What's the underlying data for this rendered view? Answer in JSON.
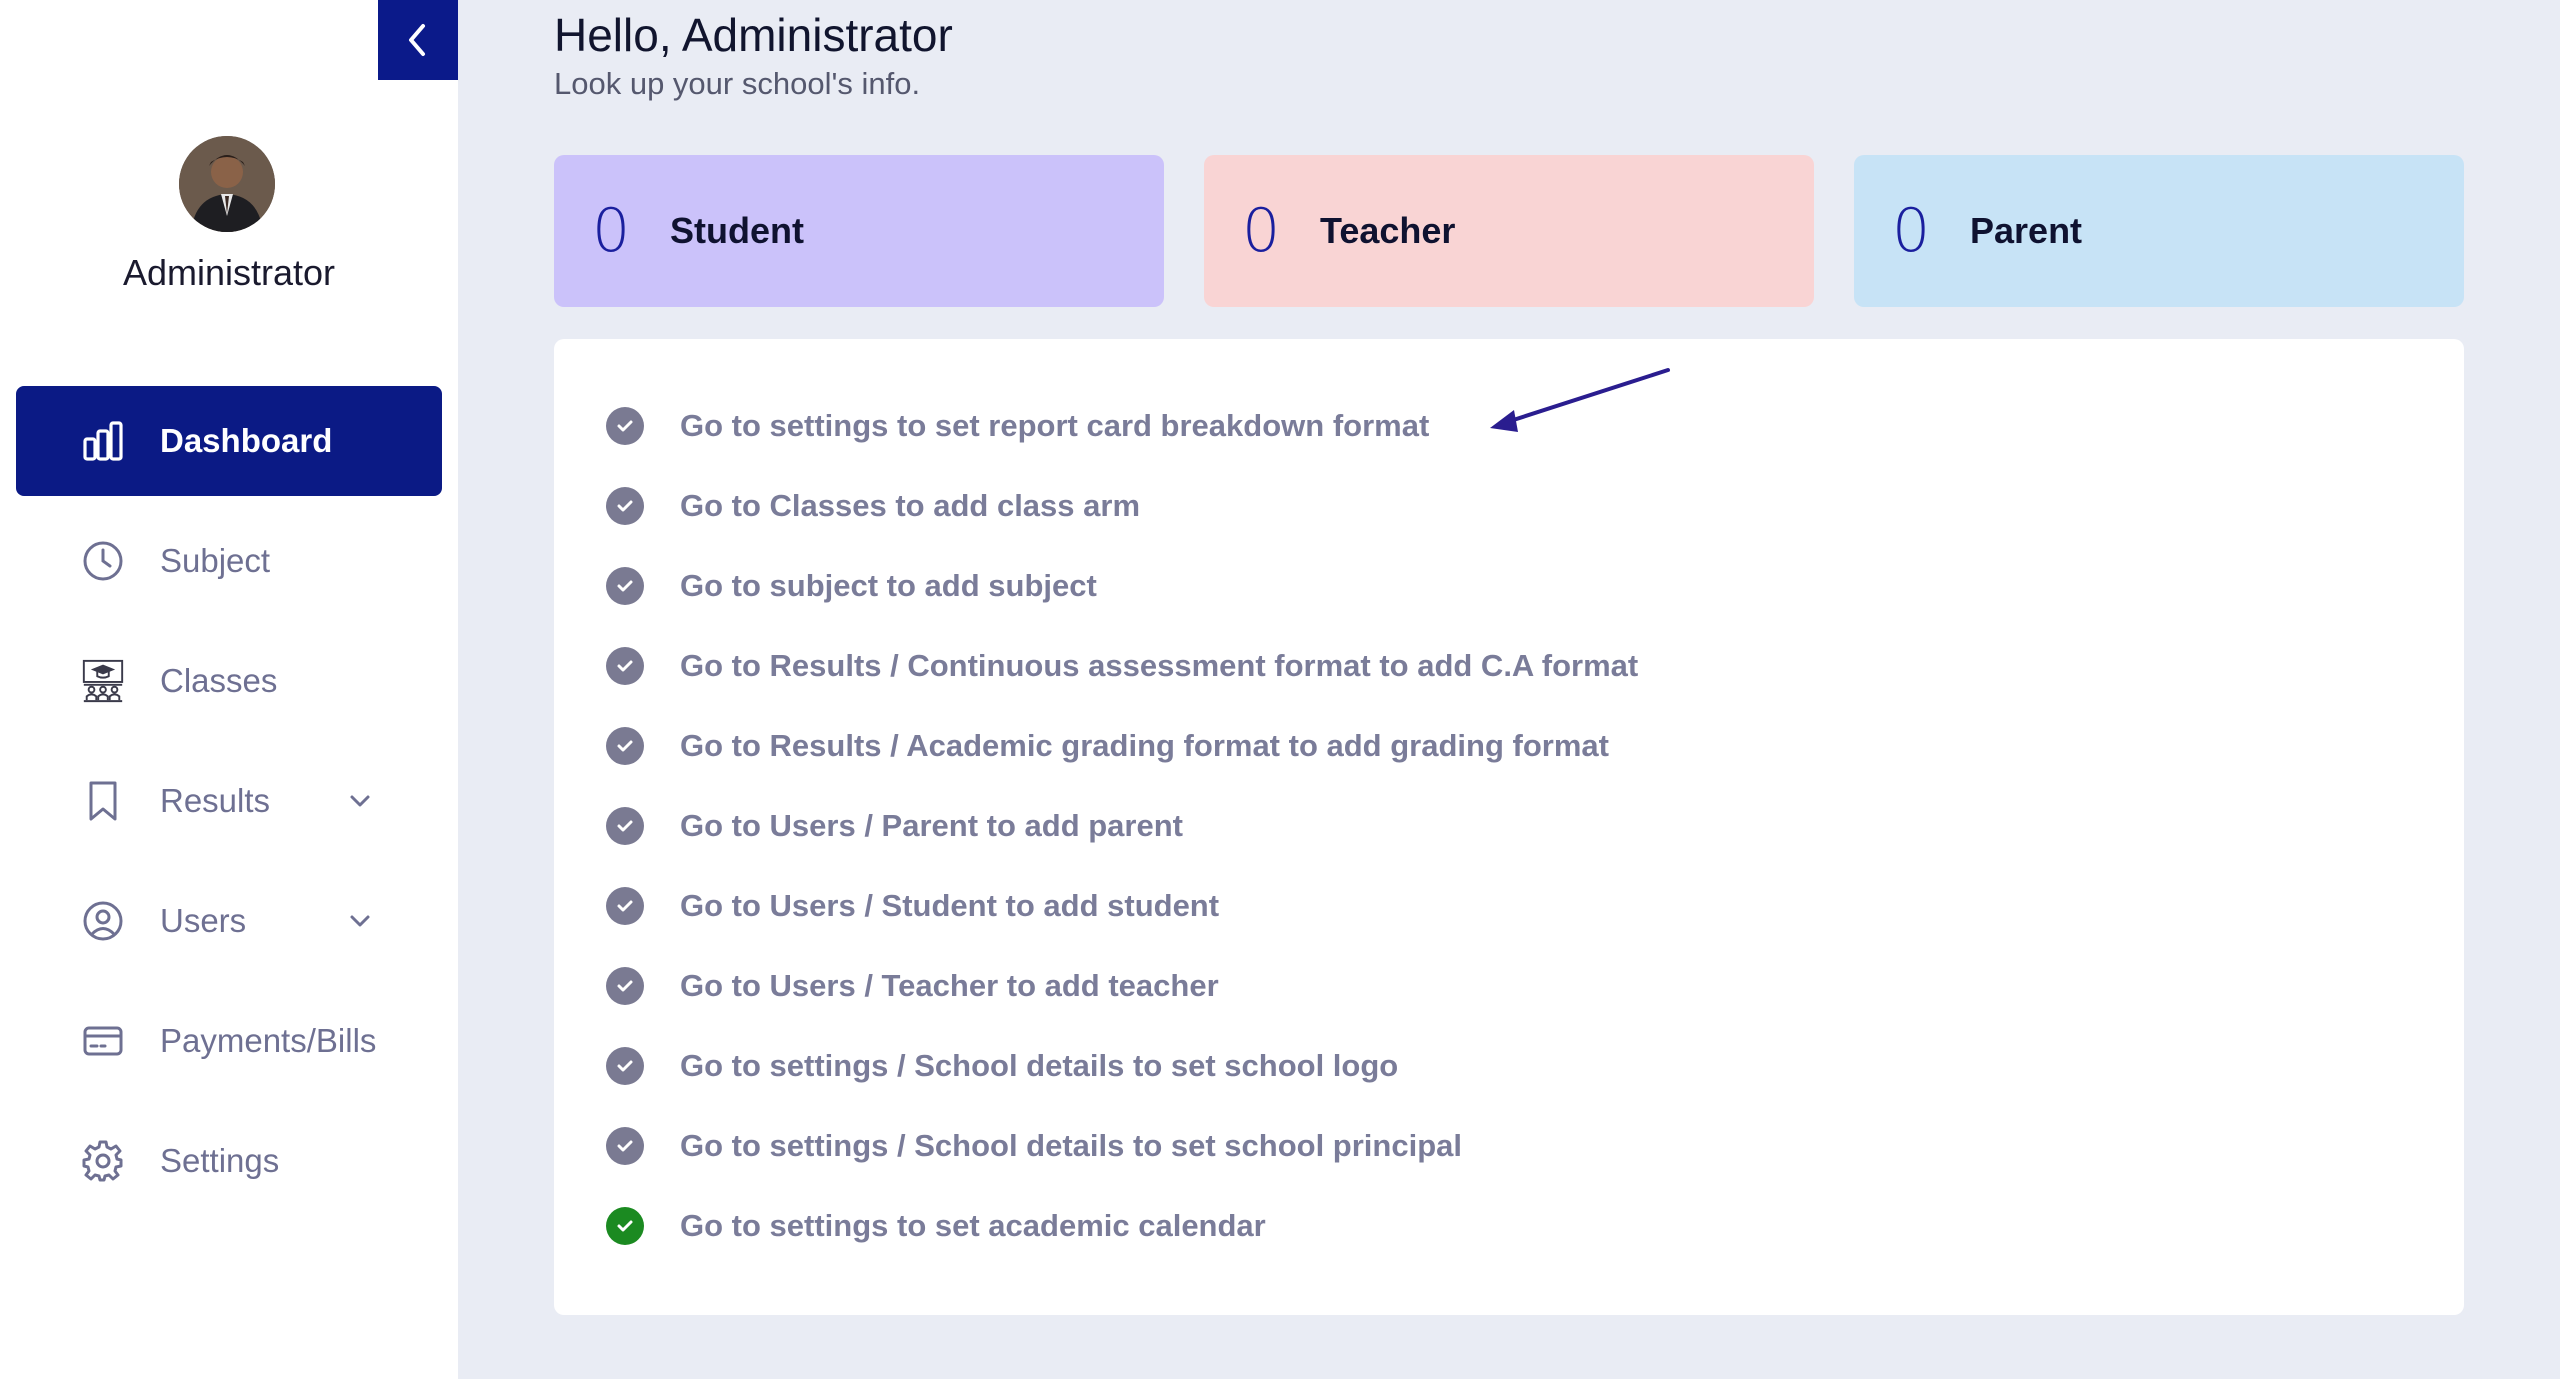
{
  "sidebar": {
    "collapse_icon": "chevron-left-icon",
    "user_name": "Administrator",
    "items": [
      {
        "label": "Dashboard",
        "icon": "bar-chart-icon",
        "active": true
      },
      {
        "label": "Subject",
        "icon": "clock-icon"
      },
      {
        "label": "Classes",
        "icon": "classroom-icon"
      },
      {
        "label": "Results",
        "icon": "bookmark-icon",
        "has_dropdown": true
      },
      {
        "label": "Users",
        "icon": "user-circle-icon",
        "has_dropdown": true
      },
      {
        "label": "Payments/Bills",
        "icon": "credit-card-icon"
      },
      {
        "label": "Settings",
        "icon": "gear-icon"
      }
    ]
  },
  "header": {
    "greeting": "Hello, Administrator",
    "subtitle": "Look up your school's info."
  },
  "stats": [
    {
      "count": "0",
      "label": "Student",
      "bg": "#cbc2fa"
    },
    {
      "count": "0",
      "label": "Teacher",
      "bg": "#f9d4d4"
    },
    {
      "count": "0",
      "label": "Parent",
      "bg": "#c7e3f6"
    }
  ],
  "checklist": [
    {
      "text": "Go to settings to set report card breakdown format",
      "done": false
    },
    {
      "text": "Go to Classes to add class arm",
      "done": false
    },
    {
      "text": "Go to subject to add subject",
      "done": false
    },
    {
      "text": "Go to Results / Continuous assessment format to add C.A format",
      "done": false
    },
    {
      "text": "Go to Results / Academic grading format to add grading format",
      "done": false
    },
    {
      "text": "Go to Users / Parent to add parent",
      "done": false
    },
    {
      "text": "Go to Users / Student to add student",
      "done": false
    },
    {
      "text": "Go to Users / Teacher to add teacher",
      "done": false
    },
    {
      "text": "Go to settings / School details to set school logo",
      "done": false
    },
    {
      "text": "Go to settings / School details to set school principal",
      "done": false
    },
    {
      "text": "Go to settings to set academic calendar",
      "done": true
    }
  ],
  "colors": {
    "accent": "#0b1a85",
    "check_pending": "#7a7a92",
    "check_done": "#1b8a21",
    "annotation_arrow": "#2a1d8f"
  }
}
